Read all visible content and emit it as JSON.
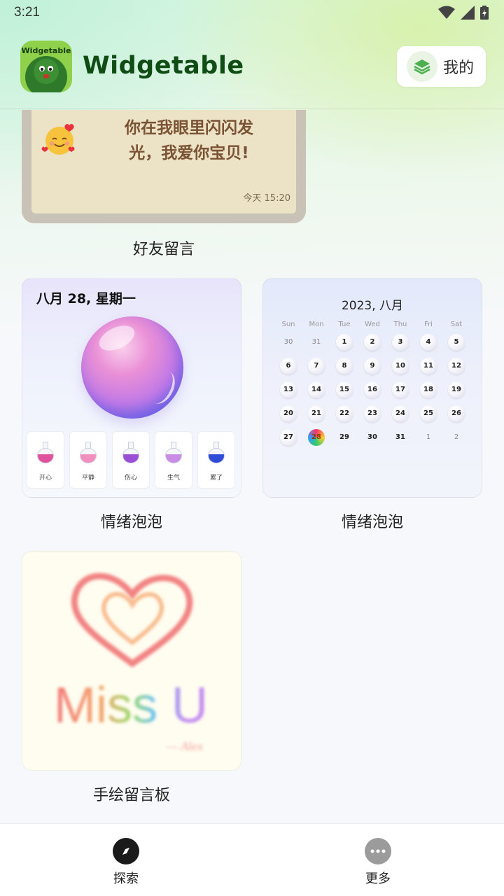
{
  "status_bar": {
    "time": "3:21",
    "icons": [
      "wifi-icon",
      "signal-icon",
      "battery-icon"
    ]
  },
  "header": {
    "app_title": "Widgetable",
    "logo_text": "Widgetable",
    "me_label": "我的"
  },
  "widgets": {
    "friend_message": {
      "text": "你在我眼里闪闪发光，我爱你宝贝!",
      "time": "今天 15:20",
      "caption": "好友留言"
    },
    "mood_bubble": {
      "date": "八月 28, 星期一",
      "caption": "情绪泡泡",
      "moods": [
        {
          "label": "开心",
          "color": "#e0519e"
        },
        {
          "label": "平静",
          "color": "#f28fbf"
        },
        {
          "label": "伤心",
          "color": "#9a4fd6"
        },
        {
          "label": "生气",
          "color": "#c98ce6"
        },
        {
          "label": "累了",
          "color": "#2f4bd8"
        }
      ]
    },
    "mood_calendar": {
      "title": "2023, 八月",
      "caption": "情绪泡泡",
      "weekdays": [
        "Sun",
        "Mon",
        "Tue",
        "Wed",
        "Thu",
        "Fri",
        "Sat"
      ],
      "weeks": [
        [
          "30",
          "31",
          "1",
          "2",
          "3",
          "4",
          "5"
        ],
        [
          "6",
          "7",
          "8",
          "9",
          "10",
          "11",
          "12"
        ],
        [
          "13",
          "14",
          "15",
          "16",
          "17",
          "18",
          "19"
        ],
        [
          "20",
          "21",
          "22",
          "23",
          "24",
          "25",
          "26"
        ],
        [
          "27",
          "28",
          "29",
          "30",
          "31",
          "1",
          "2"
        ]
      ],
      "today": "28"
    },
    "hand_drawn_board": {
      "drawing_text": "Miss U",
      "signature": "— Alex",
      "caption": "手绘留言板"
    }
  },
  "bottom_nav": {
    "items": [
      {
        "label": "探索",
        "icon": "compass-icon"
      },
      {
        "label": "更多",
        "icon": "more-icon"
      }
    ]
  },
  "colors": {
    "title_green": "#0f4d14",
    "accent_green": "#4caf50"
  }
}
